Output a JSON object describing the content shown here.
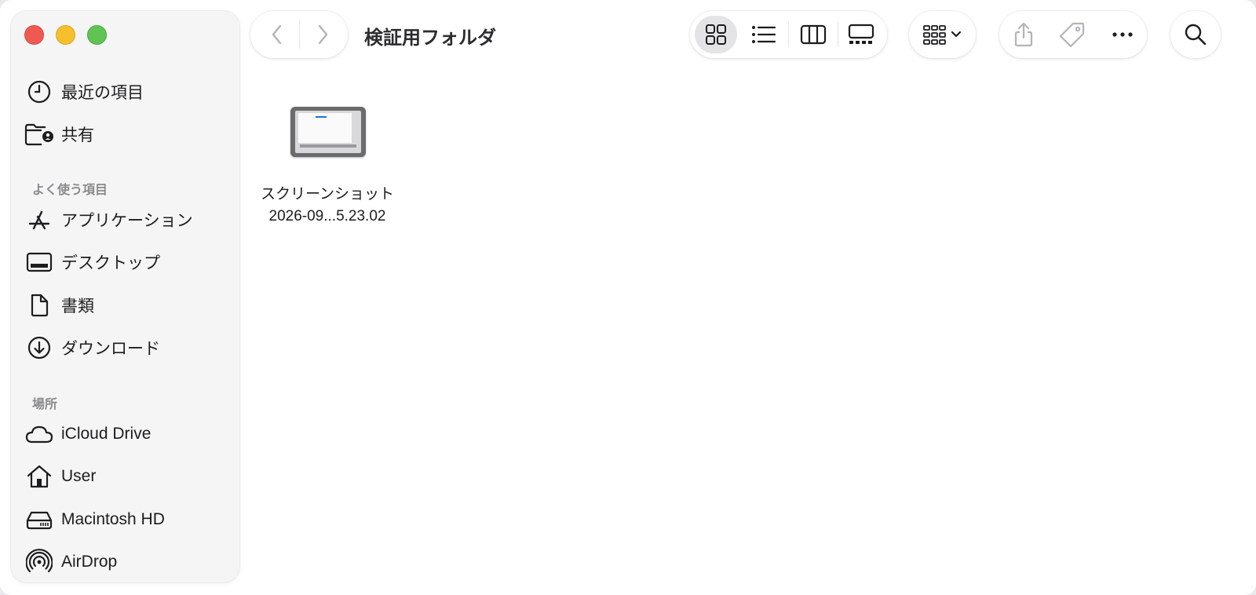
{
  "window": {
    "title": "検証用フォルダ"
  },
  "sidebar": {
    "top_items": [
      {
        "label": "最近の項目",
        "icon": "clock-icon"
      },
      {
        "label": "共有",
        "icon": "shared-folder-icon"
      }
    ],
    "favorites_header": "よく使う項目",
    "favorites": [
      {
        "label": "アプリケーション",
        "icon": "applications-icon"
      },
      {
        "label": "デスクトップ",
        "icon": "desktop-icon"
      },
      {
        "label": "書類",
        "icon": "document-icon"
      },
      {
        "label": "ダウンロード",
        "icon": "download-icon"
      }
    ],
    "locations_header": "場所",
    "locations": [
      {
        "label": "iCloud Drive",
        "icon": "cloud-icon"
      },
      {
        "label": "User",
        "icon": "home-icon"
      },
      {
        "label": "Macintosh HD",
        "icon": "hard-drive-icon"
      },
      {
        "label": "AirDrop",
        "icon": "airdrop-icon"
      }
    ]
  },
  "toolbar": {
    "back_icon": "chevron-left-icon",
    "forward_icon": "chevron-right-icon",
    "view_modes": [
      "icon-view",
      "list-view",
      "column-view",
      "gallery-view"
    ],
    "active_view": "icon-view",
    "group_icon": "group-by-icon",
    "share_icon": "share-icon",
    "tag_icon": "tag-icon",
    "more_icon": "ellipsis-icon",
    "search_icon": "search-icon"
  },
  "files": [
    {
      "name_line1": "スクリーンショット",
      "name_line2": "2026-09...5.23.02"
    }
  ],
  "colors": {
    "close": "#ee5a52",
    "minimize": "#f5c02c",
    "maximize": "#5fc454",
    "accent": "#1a73e8"
  }
}
